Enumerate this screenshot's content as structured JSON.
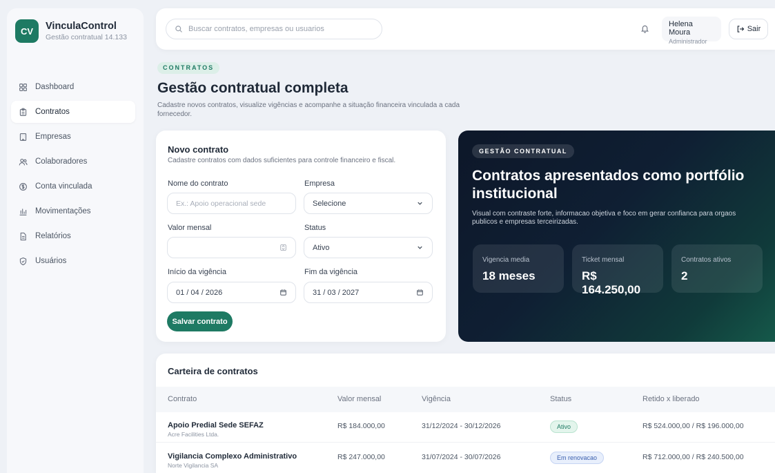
{
  "brand": {
    "initials": "CV",
    "name": "VinculaControl",
    "subtitle": "Gestão contratual 14.133"
  },
  "sidebar": {
    "items": [
      {
        "label": "Dashboard",
        "icon": "grid-icon"
      },
      {
        "label": "Contratos",
        "icon": "clipboard-icon"
      },
      {
        "label": "Empresas",
        "icon": "building-icon"
      },
      {
        "label": "Colaboradores",
        "icon": "users-icon"
      },
      {
        "label": "Conta vinculada",
        "icon": "coin-icon"
      },
      {
        "label": "Movimentações",
        "icon": "bar-chart-icon"
      },
      {
        "label": "Relatórios",
        "icon": "document-icon"
      },
      {
        "label": "Usuários",
        "icon": "shield-check-icon"
      }
    ],
    "active_item": "Contratos"
  },
  "header": {
    "search_placeholder": "Buscar contratos, empresas ou usuarios",
    "user_name": "Helena Moura",
    "user_role": "Administrador",
    "logout_label": "Sair"
  },
  "page": {
    "tag": "CONTRATOS",
    "title": "Gestão contratual completa",
    "description": "Cadastre novos contratos, visualize vigências e acompanhe a situação financeira vinculada a cada fornecedor."
  },
  "form": {
    "title": "Novo contrato",
    "subtitle": "Cadastre contratos com dados suficientes para controle financeiro e fiscal.",
    "contract_name_label": "Nome do contrato",
    "contract_name_placeholder": "Ex.: Apoio operacional sede",
    "company_label": "Empresa",
    "company_value": "Selecione",
    "monthly_value_label": "Valor mensal",
    "monthly_value": "",
    "status_label": "Status",
    "status_value": "Ativo",
    "start_label": "Início da vigência",
    "start_value": "01 / 04 / 2026",
    "end_label": "Fim da vigência",
    "end_value": "31 / 03 / 2027",
    "save_label": "Salvar contrato"
  },
  "hero": {
    "tag": "GESTÃO CONTRATUAL",
    "title": "Contratos apresentados como portfólio institucional",
    "description": "Visual com contraste forte, informacao objetiva e foco em gerar confianca para orgaos publicos e empresas terceirizadas.",
    "stats": [
      {
        "label": "Vigencia media",
        "value": "18 meses"
      },
      {
        "label": "Ticket mensal",
        "value": "R$ 164.250,00"
      },
      {
        "label": "Contratos ativos",
        "value": "2"
      }
    ]
  },
  "table": {
    "title": "Carteira de contratos",
    "columns": [
      "Contrato",
      "Valor mensal",
      "Vigência",
      "Status",
      "Retido x liberado"
    ],
    "rows": [
      {
        "name": "Apoio Predial Sede SEFAZ",
        "company": "Acre Facilities Ltda.",
        "value": "R$ 184.000,00",
        "period": "31/12/2024 - 30/12/2026",
        "status": "Ativo",
        "retained": "R$ 524.000,00 / R$ 196.000,00"
      },
      {
        "name": "Vigilancia Complexo Administrativo",
        "company": "Norte Vigilancia SA",
        "value": "R$ 247.000,00",
        "period": "31/07/2024 - 30/07/2026",
        "status": "Em renovacao",
        "retained": "R$ 712.000,00 / R$ 240.500,00"
      }
    ]
  },
  "colors": {
    "accent": "#1e7a63",
    "hero_dark": "#0d1729",
    "badge_active": "#e3f5ec",
    "badge_renewal": "#e8effc"
  }
}
